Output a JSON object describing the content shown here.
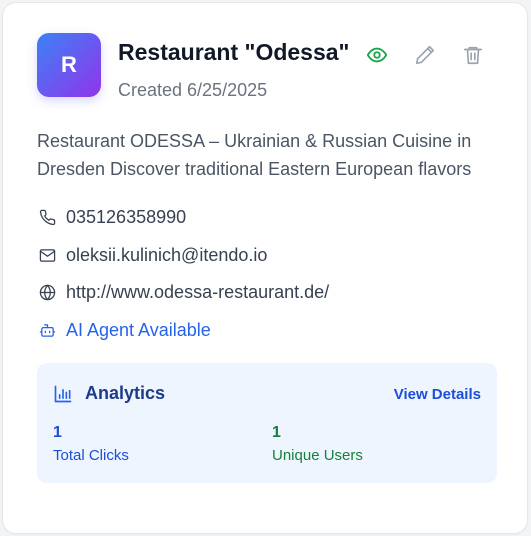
{
  "card": {
    "avatar_letter": "R",
    "title": "Restaurant \"Odessa\"",
    "created": "Created 6/25/2025",
    "description": "Restaurant ODESSA – Ukrainian & Russian Cuisine in Dresden Discover traditional Eastern European flavors",
    "actions": {
      "view_icon": "eye-icon",
      "edit_icon": "pencil-icon",
      "delete_icon": "trash-icon"
    },
    "contact": {
      "phone": "035126358990",
      "email": "oleksii.kulinich@itendo.io",
      "website": "http://www.odessa-restaurant.de/",
      "ai_agent": "AI Agent Available"
    }
  },
  "analytics": {
    "title": "Analytics",
    "view_details": "View Details",
    "total_clicks": {
      "value": "1",
      "label": "Total Clicks"
    },
    "unique_users": {
      "value": "1",
      "label": "Unique Users"
    }
  },
  "colors": {
    "accent_blue": "#2563eb",
    "view_green": "#16a34a",
    "users_green": "#15803d",
    "analytics_bg": "#eef5ff"
  }
}
